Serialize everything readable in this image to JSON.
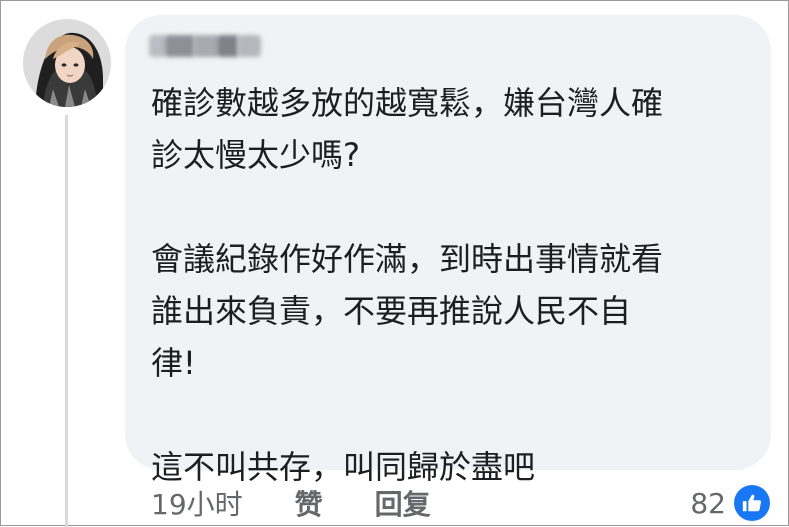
{
  "comment": {
    "author_name": "",
    "lines": [
      "確診數越多放的越寬鬆，嫌台灣人確",
      "診太慢太少嗎?",
      "",
      "會議紀錄作好作滿，到時出事情就看",
      "誰出來負責，不要再推說人民不自",
      "律!",
      "",
      "這不叫共存，叫同歸於盡吧"
    ],
    "timestamp": "19小时",
    "like_label": "赞",
    "reply_label": "回复",
    "reaction_count": "82"
  },
  "icons": {
    "avatar": "user-avatar-photo",
    "reaction": "thumbs-up-icon"
  },
  "colors": {
    "bubble": "#f0f2f5",
    "text": "#1c1e21",
    "meta": "#65676b",
    "like_blue": "#1877f2"
  }
}
